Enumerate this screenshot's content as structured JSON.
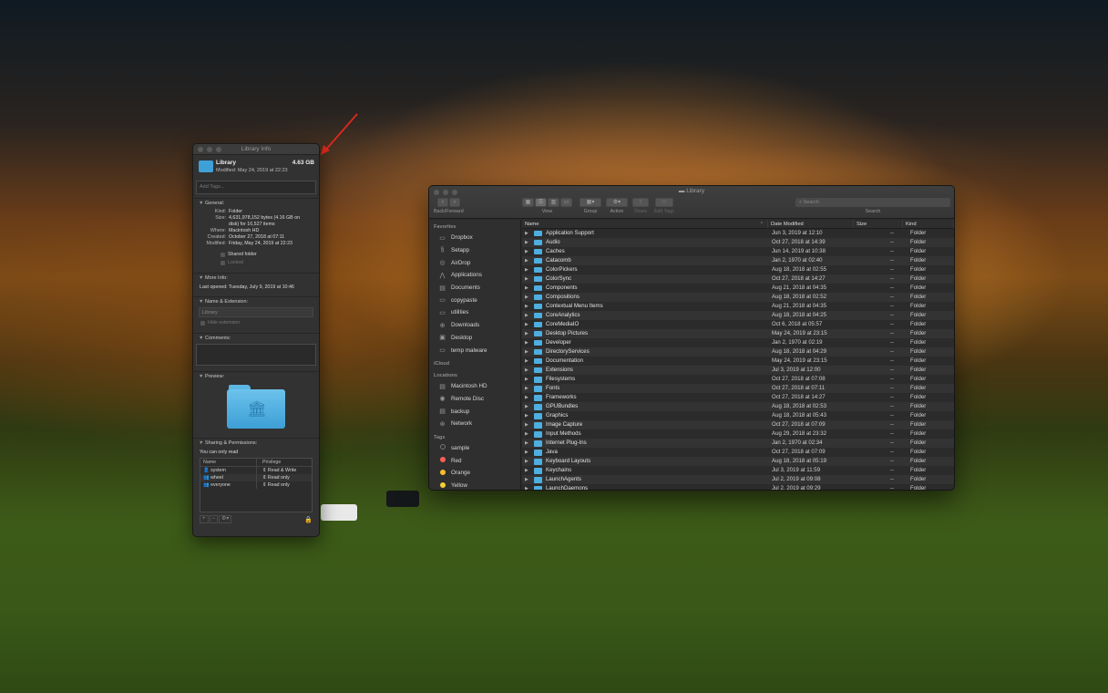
{
  "info_window": {
    "title": "Library Info",
    "name": "Library",
    "size": "4.63 GB",
    "modified_line": "Modified: May 24, 2019 at 22:23",
    "tags_placeholder": "Add Tags...",
    "general": {
      "header": "General:",
      "kind_label": "Kind:",
      "kind": "Folder",
      "size_label": "Size:",
      "size_line1": "4,631,978,152 bytes (4.16 GB on",
      "size_line2": "disk) for 16,527 items",
      "where_label": "Where:",
      "where": "Macintosh HD",
      "created_label": "Created:",
      "created": "October 27, 2018 at 07:11",
      "modified_label": "Modified:",
      "modified": "Friday, May 24, 2019 at 22:23",
      "shared_label": "Shared folder",
      "locked_label": "Locked"
    },
    "more_info": {
      "header": "More Info:",
      "last_opened": "Last opened: Tuesday, July 9, 2019 at 10:46"
    },
    "name_ext": {
      "header": "Name & Extension:",
      "value": "Library",
      "hide_ext": "Hide extension"
    },
    "comments": {
      "header": "Comments:"
    },
    "preview": {
      "header": "Preview:"
    },
    "sharing": {
      "header": "Sharing & Permissions:",
      "note": "You can only read",
      "col_name": "Name",
      "col_privilege": "Privilege",
      "rows": [
        {
          "name": "system",
          "privilege": "Read & Write"
        },
        {
          "name": "wheel",
          "privilege": "Read only"
        },
        {
          "name": "everyone",
          "privilege": "Read only"
        }
      ]
    }
  },
  "finder": {
    "title": "Library",
    "toolbar": {
      "back_forward": "Back/Forward",
      "view": "View",
      "group": "Group",
      "action": "Action",
      "share": "Share",
      "edit_tags": "Edit Tags",
      "search_placeholder": "Search",
      "search_label": "Search"
    },
    "sidebar": {
      "favorites_header": "Favorites",
      "favorites": [
        {
          "label": "Dropbox",
          "icon": "folder-icon"
        },
        {
          "label": "Setapp",
          "icon": "setapp-icon"
        },
        {
          "label": "AirDrop",
          "icon": "airdrop-icon"
        },
        {
          "label": "Applications",
          "icon": "applications-icon"
        },
        {
          "label": "Documents",
          "icon": "document-icon"
        },
        {
          "label": "copypaste",
          "icon": "folder-icon"
        },
        {
          "label": "utilities",
          "icon": "folder-icon"
        },
        {
          "label": "Downloads",
          "icon": "downloads-icon"
        },
        {
          "label": "Desktop",
          "icon": "desktop-icon"
        },
        {
          "label": "temp malware",
          "icon": "folder-icon"
        }
      ],
      "icloud_header": "iCloud",
      "locations_header": "Locations",
      "locations": [
        {
          "label": "Macintosh HD",
          "icon": "disk-icon"
        },
        {
          "label": "Remote Disc",
          "icon": "disc-icon"
        },
        {
          "label": "backup",
          "icon": "disk-icon"
        },
        {
          "label": "Network",
          "icon": "network-icon"
        }
      ],
      "tags_header": "Tags",
      "tags": [
        {
          "label": "sample",
          "color": "#555555"
        },
        {
          "label": "Red",
          "color": "#ff5f56"
        },
        {
          "label": "Orange",
          "color": "#ffbd2e"
        },
        {
          "label": "Yellow",
          "color": "#f5d033"
        }
      ]
    },
    "columns": {
      "name": "Name",
      "date": "Date Modified",
      "size": "Size",
      "kind": "Kind"
    },
    "rows": [
      {
        "name": "Application Support",
        "date": "Jun 3, 2019 at 12:10",
        "size": "--",
        "kind": "Folder"
      },
      {
        "name": "Audio",
        "date": "Oct 27, 2018 at 14:39",
        "size": "--",
        "kind": "Folder"
      },
      {
        "name": "Caches",
        "date": "Jun 14, 2019 at 10:38",
        "size": "--",
        "kind": "Folder"
      },
      {
        "name": "Catacomb",
        "date": "Jan 2, 1970 at 02:40",
        "size": "--",
        "kind": "Folder"
      },
      {
        "name": "ColorPickers",
        "date": "Aug 18, 2018 at 02:55",
        "size": "--",
        "kind": "Folder"
      },
      {
        "name": "ColorSync",
        "date": "Oct 27, 2018 at 14:27",
        "size": "--",
        "kind": "Folder"
      },
      {
        "name": "Components",
        "date": "Aug 21, 2018 at 04:35",
        "size": "--",
        "kind": "Folder"
      },
      {
        "name": "Compositions",
        "date": "Aug 18, 2018 at 02:52",
        "size": "--",
        "kind": "Folder"
      },
      {
        "name": "Contextual Menu Items",
        "date": "Aug 21, 2018 at 04:35",
        "size": "--",
        "kind": "Folder"
      },
      {
        "name": "CoreAnalytics",
        "date": "Aug 18, 2018 at 04:25",
        "size": "--",
        "kind": "Folder"
      },
      {
        "name": "CoreMediaIO",
        "date": "Oct 6, 2018 at 05:57",
        "size": "--",
        "kind": "Folder"
      },
      {
        "name": "Desktop Pictures",
        "date": "May 24, 2019 at 23:15",
        "size": "--",
        "kind": "Folder"
      },
      {
        "name": "Developer",
        "date": "Jan 2, 1970 at 02:19",
        "size": "--",
        "kind": "Folder"
      },
      {
        "name": "DirectoryServices",
        "date": "Aug 18, 2018 at 04:29",
        "size": "--",
        "kind": "Folder"
      },
      {
        "name": "Documentation",
        "date": "May 24, 2019 at 23:15",
        "size": "--",
        "kind": "Folder"
      },
      {
        "name": "Extensions",
        "date": "Jul 3, 2019 at 12:00",
        "size": "--",
        "kind": "Folder"
      },
      {
        "name": "Filesystems",
        "date": "Oct 27, 2018 at 07:08",
        "size": "--",
        "kind": "Folder"
      },
      {
        "name": "Fonts",
        "date": "Oct 27, 2018 at 07:11",
        "size": "--",
        "kind": "Folder"
      },
      {
        "name": "Frameworks",
        "date": "Oct 27, 2018 at 14:27",
        "size": "--",
        "kind": "Folder"
      },
      {
        "name": "GPUBundles",
        "date": "Aug 18, 2018 at 02:53",
        "size": "--",
        "kind": "Folder"
      },
      {
        "name": "Graphics",
        "date": "Aug 18, 2018 at 05:43",
        "size": "--",
        "kind": "Folder"
      },
      {
        "name": "Image Capture",
        "date": "Oct 27, 2018 at 07:09",
        "size": "--",
        "kind": "Folder"
      },
      {
        "name": "Input Methods",
        "date": "Aug 29, 2018 at 23:32",
        "size": "--",
        "kind": "Folder"
      },
      {
        "name": "Internet Plug-Ins",
        "date": "Jan 2, 1970 at 02:34",
        "size": "--",
        "kind": "Folder"
      },
      {
        "name": "Java",
        "date": "Oct 27, 2018 at 07:09",
        "size": "--",
        "kind": "Folder"
      },
      {
        "name": "Keyboard Layouts",
        "date": "Aug 18, 2018 at 05:19",
        "size": "--",
        "kind": "Folder"
      },
      {
        "name": "Keychains",
        "date": "Jul 3, 2019 at 11:59",
        "size": "--",
        "kind": "Folder"
      },
      {
        "name": "LaunchAgents",
        "date": "Jul 2, 2019 at 09:08",
        "size": "--",
        "kind": "Folder"
      },
      {
        "name": "LaunchDaemons",
        "date": "Jul 2, 2019 at 09:29",
        "size": "--",
        "kind": "Folder"
      }
    ]
  }
}
